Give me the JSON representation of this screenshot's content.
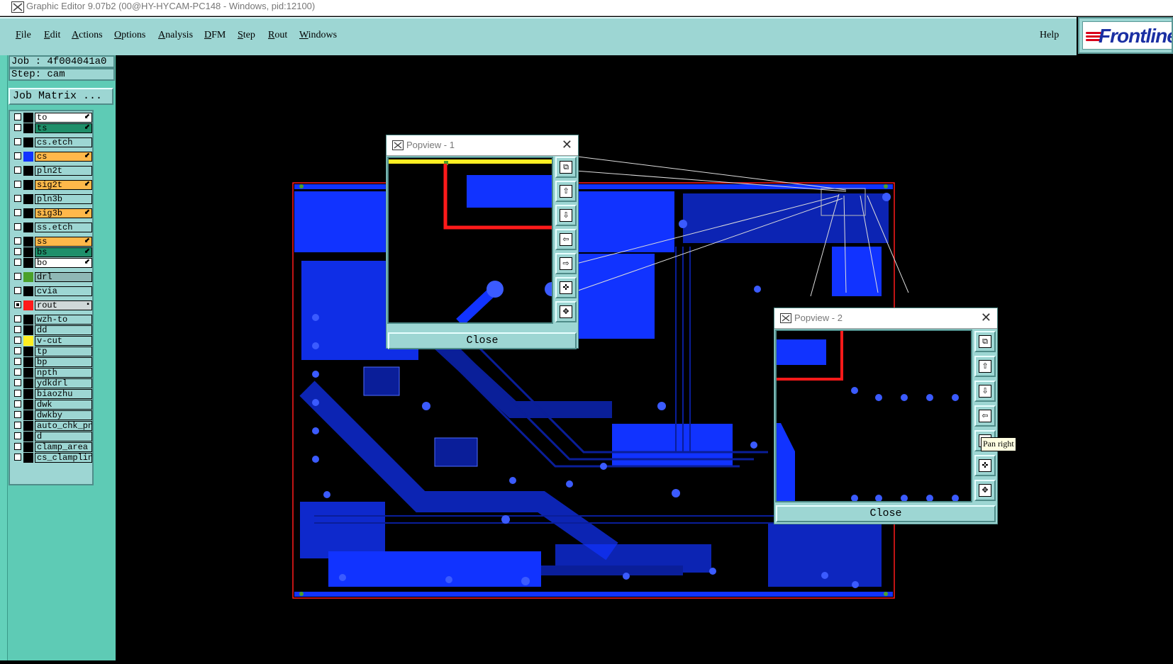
{
  "window": {
    "title": "Graphic Editor 9.07b2 (00@HY-HYCAM-PC148 - Windows, pid:12100)"
  },
  "menu": {
    "items": [
      "File",
      "Edit",
      "Actions",
      "Options",
      "Analysis",
      "DFM",
      "Step",
      "Rout",
      "Windows"
    ],
    "help": "Help"
  },
  "brand": {
    "logo_text": "Frontline"
  },
  "job": {
    "job_label": "Job : 4f004041a0",
    "step_label": "Step: cam",
    "matrix_button": "Job Matrix ..."
  },
  "layers": [
    {
      "name": "to",
      "color": "#ffffff",
      "swatch": "#000000",
      "marker": "⬋",
      "checked": false
    },
    {
      "name": "ts",
      "color": "#1f8f6a",
      "swatch": "#000000",
      "marker": "⬋",
      "checked": false
    },
    {
      "name": "cs.etch",
      "color": "#9dd6d3",
      "swatch": "#000000",
      "marker": "",
      "checked": false
    },
    {
      "name": "cs",
      "color": "#ffb84a",
      "swatch": "#1133ff",
      "marker": "⬋",
      "checked": false
    },
    {
      "name": "pln2t",
      "color": "#9dd6d3",
      "swatch": "#000000",
      "marker": "",
      "checked": false
    },
    {
      "name": "sig2t",
      "color": "#ffb84a",
      "swatch": "#000000",
      "marker": "⬋",
      "checked": false
    },
    {
      "name": "pln3b",
      "color": "#9dd6d3",
      "swatch": "#000000",
      "marker": "",
      "checked": false
    },
    {
      "name": "sig3b",
      "color": "#ffb84a",
      "swatch": "#000000",
      "marker": "⬋",
      "checked": false
    },
    {
      "name": "ss.etch",
      "color": "#9dd6d3",
      "swatch": "#000000",
      "marker": "",
      "checked": false
    },
    {
      "name": "ss",
      "color": "#ffb84a",
      "swatch": "#000000",
      "marker": "⬋",
      "checked": false
    },
    {
      "name": "bs",
      "color": "#1f8f6a",
      "swatch": "#000000",
      "marker": "⬋",
      "checked": false
    },
    {
      "name": "bo",
      "color": "#ffffff",
      "swatch": "#000000",
      "marker": "⬋",
      "checked": false
    },
    {
      "name": "drl",
      "color": "#8fb8b6",
      "swatch": "#4aa02a",
      "marker": "",
      "checked": false
    },
    {
      "name": "cvia",
      "color": "#9dd6d3",
      "swatch": "#000000",
      "marker": "",
      "checked": false
    },
    {
      "name": "rout",
      "color": "#cfd8d8",
      "swatch": "#ff1a1a",
      "marker": "▪",
      "checked": true
    },
    {
      "name": "wzh-to",
      "color": "#9dd6d3",
      "swatch": "#000000",
      "marker": "",
      "checked": false
    },
    {
      "name": "dd",
      "color": "#9dd6d3",
      "swatch": "#000000",
      "marker": "",
      "checked": false
    },
    {
      "name": "v-cut",
      "color": "#9dd6d3",
      "swatch": "#ffee22",
      "marker": "",
      "checked": false
    },
    {
      "name": "tp",
      "color": "#9dd6d3",
      "swatch": "#000000",
      "marker": "",
      "checked": false
    },
    {
      "name": "bp",
      "color": "#9dd6d3",
      "swatch": "#000000",
      "marker": "",
      "checked": false
    },
    {
      "name": "npth",
      "color": "#9dd6d3",
      "swatch": "#000000",
      "marker": "",
      "checked": false
    },
    {
      "name": "ydkdrl",
      "color": "#9dd6d3",
      "swatch": "#000000",
      "marker": "",
      "checked": false
    },
    {
      "name": "biaozhu",
      "color": "#9dd6d3",
      "swatch": "#000000",
      "marker": "",
      "checked": false
    },
    {
      "name": "dwk",
      "color": "#9dd6d3",
      "swatch": "#000000",
      "marker": "",
      "checked": false
    },
    {
      "name": "dwkby",
      "color": "#9dd6d3",
      "swatch": "#000000",
      "marker": "",
      "checked": false
    },
    {
      "name": "auto_chk_pnl",
      "color": "#9dd6d3",
      "swatch": "#000000",
      "marker": "",
      "checked": false
    },
    {
      "name": "d",
      "color": "#9dd6d3",
      "swatch": "#000000",
      "marker": "",
      "checked": false
    },
    {
      "name": "clamp_area",
      "color": "#9dd6d3",
      "swatch": "#000000",
      "marker": "",
      "checked": false
    },
    {
      "name": "cs_clampline",
      "color": "#9dd6d3",
      "swatch": "#000000",
      "marker": "",
      "checked": false
    }
  ],
  "popview1": {
    "title": "Popview - 1",
    "close_label": "Close"
  },
  "popview2": {
    "title": "Popview - 2",
    "close_label": "Close"
  },
  "popview_buttons": [
    "zoom-fit",
    "pan-up",
    "pan-down",
    "pan-left",
    "pan-right",
    "zoom-in",
    "zoom-out"
  ],
  "tooltip": "Pan right",
  "colors": {
    "panel": "#9dd6d3",
    "sidebar": "#5ecbb5",
    "copper": "#1133ff",
    "rout": "#ff1a1a"
  }
}
